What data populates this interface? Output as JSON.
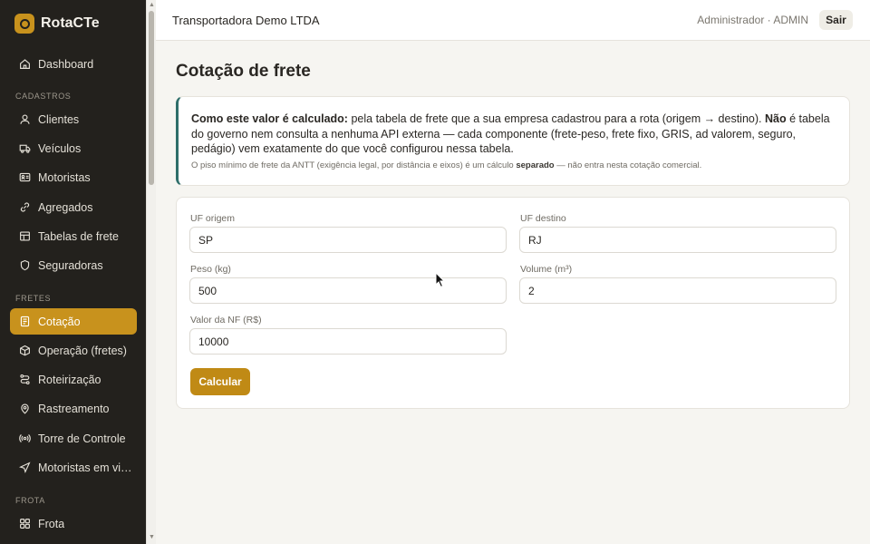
{
  "brand": {
    "name": "RotaCTe"
  },
  "sidebar": {
    "dashboard": "Dashboard",
    "sections": {
      "cadastros": "CADASTROS",
      "fretes": "FRETES",
      "frota": "FROTA"
    },
    "cadastros_items": [
      {
        "label": "Clientes",
        "icon": "user-icon"
      },
      {
        "label": "Veículos",
        "icon": "truck-icon"
      },
      {
        "label": "Motoristas",
        "icon": "id-card-icon"
      },
      {
        "label": "Agregados",
        "icon": "link-icon"
      },
      {
        "label": "Tabelas de frete",
        "icon": "table-icon"
      },
      {
        "label": "Seguradoras",
        "icon": "shield-icon"
      }
    ],
    "fretes_items": [
      {
        "label": "Cotação",
        "icon": "document-icon",
        "active": true
      },
      {
        "label": "Operação (fretes)",
        "icon": "box-icon"
      },
      {
        "label": "Roteirização",
        "icon": "route-icon"
      },
      {
        "label": "Rastreamento",
        "icon": "map-pin-icon"
      },
      {
        "label": "Torre de Controle",
        "icon": "radio-icon"
      },
      {
        "label": "Motoristas em viagem",
        "icon": "navigation-icon"
      }
    ],
    "frota_items": [
      {
        "label": "Frota",
        "icon": "grid-icon"
      }
    ],
    "active_color": "#c8921d"
  },
  "header": {
    "company": "Transportadora Demo LTDA",
    "user": "Administrador · ADMIN",
    "logout": "Sair"
  },
  "page": {
    "title": "Cotação de frete"
  },
  "info": {
    "lead_bold": "Como este valor é calculado:",
    "text1": " pela tabela de frete que a sua empresa cadastrou para a rota (origem → destino). ",
    "bold2": "Não",
    "text2": " é tabela do governo nem consulta a nenhuma API externa — cada componente (frete-peso, frete fixo, GRIS, ad valorem, seguro, pedágio) vem exatamente do que você configurou nessa tabela.",
    "note_pre": "O piso mínimo de frete da ANTT (exigência legal, por distância e eixos) é um cálculo ",
    "note_bold": "separado",
    "note_post": " — não entra nesta cotação comercial.",
    "accent_color": "#2e6e6a"
  },
  "form": {
    "uf_origem": {
      "label": "UF origem",
      "value": "SP"
    },
    "uf_destino": {
      "label": "UF destino",
      "value": "RJ"
    },
    "peso": {
      "label": "Peso (kg)",
      "value": "500"
    },
    "volume": {
      "label": "Volume (m³)",
      "value": "2"
    },
    "valor_nf": {
      "label": "Valor da NF (R$)",
      "value": "10000"
    },
    "submit": "Calcular",
    "submit_color": "#c08a15"
  }
}
